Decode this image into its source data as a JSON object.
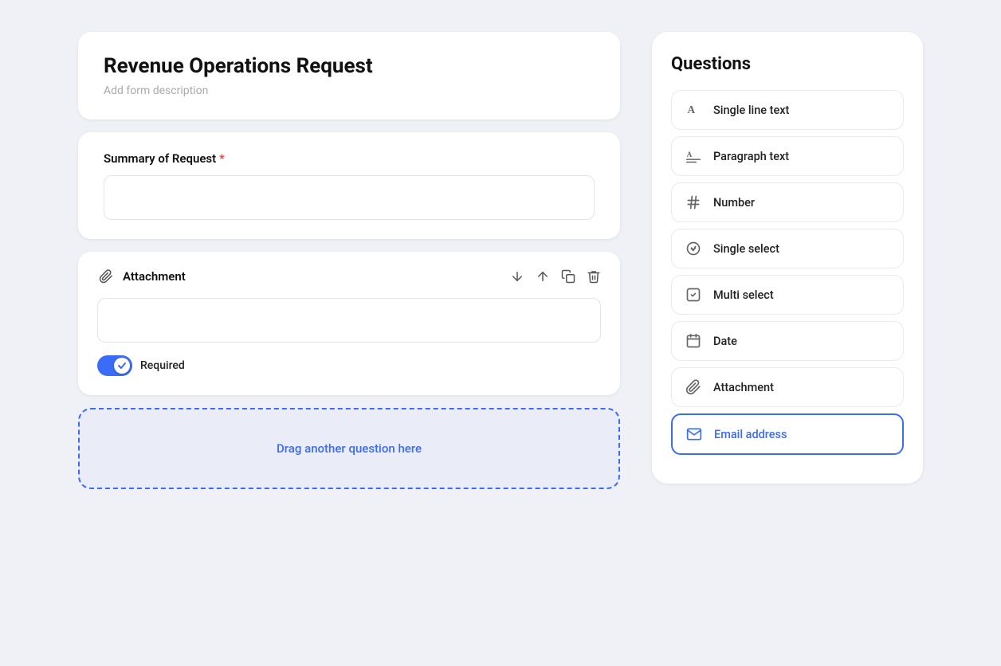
{
  "page": {
    "background_color": "#f0f1f7"
  },
  "form": {
    "title": "Revenue Operations Request",
    "description_placeholder": "Add form description",
    "fields": [
      {
        "id": "summary",
        "label": "Summary of Request",
        "required": true,
        "type": "text",
        "placeholder": ""
      },
      {
        "id": "attachment",
        "label": "Attachment",
        "type": "attachment",
        "required": true,
        "required_label": "Required"
      }
    ],
    "drop_zone_text": "Drag another question here"
  },
  "questions_panel": {
    "title": "Questions",
    "items": [
      {
        "id": "single-line-text",
        "label": "Single line text",
        "icon": "A"
      },
      {
        "id": "paragraph-text",
        "label": "Paragraph text",
        "icon": "paragraph"
      },
      {
        "id": "number",
        "label": "Number",
        "icon": "hash"
      },
      {
        "id": "single-select",
        "label": "Single select",
        "icon": "chevron-circle"
      },
      {
        "id": "multi-select",
        "label": "Multi select",
        "icon": "checkbox"
      },
      {
        "id": "date",
        "label": "Date",
        "icon": "calendar"
      },
      {
        "id": "attachment",
        "label": "Attachment",
        "icon": "paperclip"
      },
      {
        "id": "email-address",
        "label": "Email address",
        "icon": "envelope",
        "highlighted": true
      }
    ]
  },
  "icons": {
    "arrow_down": "↓",
    "arrow_up": "↑",
    "copy": "⊞",
    "trash": "🗑"
  }
}
